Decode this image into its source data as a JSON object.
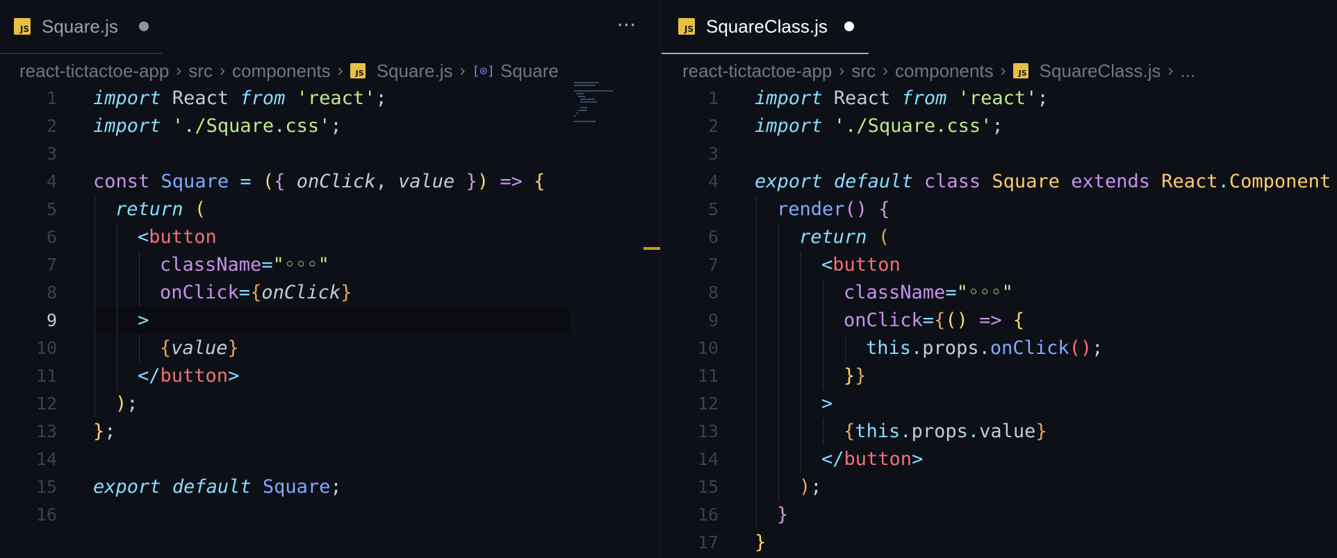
{
  "left": {
    "tab": {
      "icon": "javascript-file-icon",
      "icon_text": "JS",
      "name": "Square.js",
      "modified": true
    },
    "more_actions": "···",
    "breadcrumb": [
      "react-tictactoe-app",
      "src",
      "components",
      "Square.js",
      "Square"
    ],
    "lines": [
      {
        "n": "1",
        "parts": [
          [
            "kw-i",
            "import"
          ],
          [
            "",
            " React "
          ],
          [
            "kw-i",
            "from"
          ],
          [
            "",
            " "
          ],
          [
            "str",
            "'react'"
          ],
          [
            "",
            ";"
          ]
        ]
      },
      {
        "n": "2",
        "parts": [
          [
            "kw-i",
            "import"
          ],
          [
            "",
            " "
          ],
          [
            "str",
            "'./Square.css'"
          ],
          [
            "",
            ";"
          ]
        ]
      },
      {
        "n": "3",
        "parts": []
      },
      {
        "n": "4",
        "parts": [
          [
            "kw",
            "const"
          ],
          [
            "",
            " "
          ],
          [
            "fn",
            "Square"
          ],
          [
            "",
            " "
          ],
          [
            "pun",
            "="
          ],
          [
            "",
            " "
          ],
          [
            "br1",
            "("
          ],
          [
            "br2",
            "{"
          ],
          [
            "",
            " "
          ],
          [
            "it",
            "onClick"
          ],
          [
            "",
            ", "
          ],
          [
            "it",
            "value"
          ],
          [
            "",
            " "
          ],
          [
            "br2",
            "}"
          ],
          [
            "br1",
            ")"
          ],
          [
            "",
            " "
          ],
          [
            "kw",
            "=>"
          ],
          [
            "",
            " "
          ],
          [
            "br1",
            "{"
          ]
        ]
      },
      {
        "n": "5",
        "parts": [
          [
            "kw-i",
            "return"
          ],
          [
            "",
            " "
          ],
          [
            "br1",
            "("
          ]
        ]
      },
      {
        "n": "6",
        "parts": [
          [
            "pun",
            "<"
          ],
          [
            "tag",
            "button"
          ]
        ]
      },
      {
        "n": "7",
        "parts": [
          [
            "attr",
            "className"
          ],
          [
            "pun",
            "="
          ],
          [
            "str",
            "\"◦◦◦\""
          ]
        ]
      },
      {
        "n": "8",
        "parts": [
          [
            "attr",
            "onClick"
          ],
          [
            "pun",
            "="
          ],
          [
            "br3",
            "{"
          ],
          [
            "it",
            "onClick"
          ],
          [
            "br3",
            "}"
          ]
        ]
      },
      {
        "n": "9",
        "parts": [
          [
            "pun",
            ">"
          ]
        ]
      },
      {
        "n": "10",
        "parts": [
          [
            "br3",
            "{"
          ],
          [
            "it",
            "value"
          ],
          [
            "br3",
            "}"
          ]
        ]
      },
      {
        "n": "11",
        "parts": [
          [
            "pun",
            "</"
          ],
          [
            "tag",
            "button"
          ],
          [
            "pun",
            ">"
          ]
        ]
      },
      {
        "n": "12",
        "parts": [
          [
            "br1",
            ")"
          ],
          [
            "",
            ";"
          ]
        ]
      },
      {
        "n": "13",
        "parts": [
          [
            "br1",
            "}"
          ],
          [
            "",
            ";"
          ]
        ]
      },
      {
        "n": "14",
        "parts": []
      },
      {
        "n": "15",
        "parts": [
          [
            "kw-i",
            "export"
          ],
          [
            "",
            " "
          ],
          [
            "kw-i",
            "default"
          ],
          [
            "",
            " "
          ],
          [
            "fn",
            "Square"
          ],
          [
            "",
            ";"
          ]
        ]
      },
      {
        "n": "16",
        "parts": []
      }
    ]
  },
  "right": {
    "tab": {
      "icon": "javascript-file-icon",
      "icon_text": "JS",
      "name": "SquareClass.js",
      "modified": true
    },
    "breadcrumb": [
      "react-tictactoe-app",
      "src",
      "components",
      "SquareClass.js",
      "..."
    ],
    "lines": [
      {
        "n": "1",
        "parts": [
          [
            "kw-i",
            "import"
          ],
          [
            "",
            " React "
          ],
          [
            "kw-i",
            "from"
          ],
          [
            "",
            " "
          ],
          [
            "str",
            "'react'"
          ],
          [
            "",
            ";"
          ]
        ]
      },
      {
        "n": "2",
        "parts": [
          [
            "kw-i",
            "import"
          ],
          [
            "",
            " "
          ],
          [
            "str",
            "'./Square.css'"
          ],
          [
            "",
            ";"
          ]
        ]
      },
      {
        "n": "3",
        "parts": []
      },
      {
        "n": "4",
        "parts": [
          [
            "kw-i",
            "export"
          ],
          [
            "",
            " "
          ],
          [
            "kw-i",
            "default"
          ],
          [
            "",
            " "
          ],
          [
            "kw",
            "class"
          ],
          [
            "",
            " "
          ],
          [
            "cls",
            "Square"
          ],
          [
            "",
            " "
          ],
          [
            "kw",
            "extends"
          ],
          [
            "",
            " "
          ],
          [
            "cls",
            "React"
          ],
          [
            "pun",
            "."
          ],
          [
            "cls",
            "Component"
          ],
          [
            "",
            " "
          ],
          [
            "br1",
            "{"
          ]
        ]
      },
      {
        "n": "5",
        "parts": [
          [
            "fn",
            "render"
          ],
          [
            "br2",
            "()"
          ],
          [
            "",
            " "
          ],
          [
            "br2",
            "{"
          ]
        ]
      },
      {
        "n": "6",
        "parts": [
          [
            "kw-i",
            "return"
          ],
          [
            "",
            " "
          ],
          [
            "br3",
            "("
          ]
        ]
      },
      {
        "n": "7",
        "parts": [
          [
            "pun",
            "<"
          ],
          [
            "tag",
            "button"
          ]
        ]
      },
      {
        "n": "8",
        "parts": [
          [
            "attr",
            "className"
          ],
          [
            "pun",
            "="
          ],
          [
            "str",
            "\"◦◦◦\""
          ]
        ]
      },
      {
        "n": "9",
        "parts": [
          [
            "attr",
            "onClick"
          ],
          [
            "pun",
            "="
          ],
          [
            "br3",
            "{"
          ],
          [
            "br1",
            "()"
          ],
          [
            "",
            " "
          ],
          [
            "kw",
            "=>"
          ],
          [
            "",
            " "
          ],
          [
            "br1",
            "{"
          ]
        ]
      },
      {
        "n": "10",
        "parts": [
          [
            "thisk",
            "this"
          ],
          [
            "pun",
            "."
          ],
          [
            "",
            "props"
          ],
          [
            "pun",
            "."
          ],
          [
            "fn",
            "onClick"
          ],
          [
            "br4",
            "()"
          ],
          [
            "",
            ";"
          ]
        ]
      },
      {
        "n": "11",
        "parts": [
          [
            "br1",
            "}"
          ],
          [
            "br3",
            "}"
          ]
        ]
      },
      {
        "n": "12",
        "parts": [
          [
            "pun",
            ">"
          ]
        ]
      },
      {
        "n": "13",
        "parts": [
          [
            "br3",
            "{"
          ],
          [
            "thisk",
            "this"
          ],
          [
            "pun",
            "."
          ],
          [
            "",
            "props"
          ],
          [
            "pun",
            "."
          ],
          [
            "",
            "value"
          ],
          [
            "br3",
            "}"
          ]
        ]
      },
      {
        "n": "14",
        "parts": [
          [
            "pun",
            "</"
          ],
          [
            "tag",
            "button"
          ],
          [
            "pun",
            ">"
          ]
        ]
      },
      {
        "n": "15",
        "parts": [
          [
            "br3",
            ")"
          ],
          [
            "",
            ";"
          ]
        ]
      },
      {
        "n": "16",
        "parts": [
          [
            "br2",
            "}"
          ]
        ]
      },
      {
        "n": "17",
        "parts": [
          [
            "br1",
            "}"
          ]
        ]
      }
    ]
  }
}
